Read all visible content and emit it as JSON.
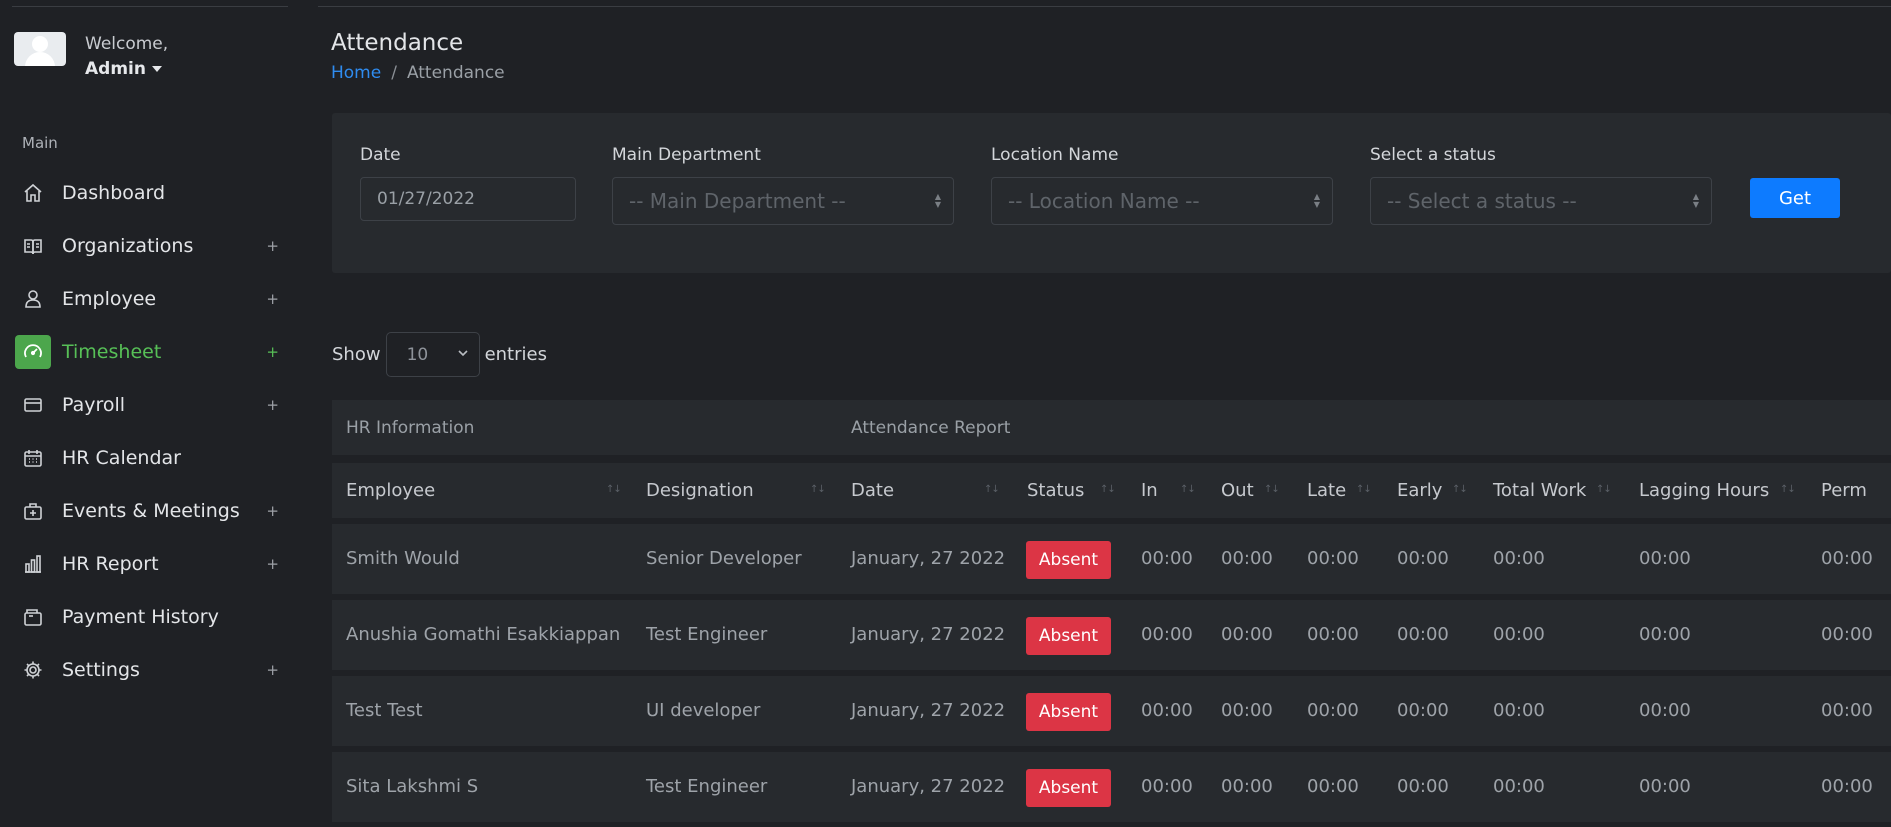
{
  "user": {
    "welcome": "Welcome,",
    "name": "Admin"
  },
  "sidebar": {
    "section_label": "Main",
    "items": [
      {
        "label": "Dashboard",
        "icon": "home-icon",
        "has_plus": false
      },
      {
        "label": "Organizations",
        "icon": "book-icon",
        "has_plus": true
      },
      {
        "label": "Employee",
        "icon": "user-icon",
        "has_plus": true
      },
      {
        "label": "Timesheet",
        "icon": "speedometer-icon",
        "has_plus": true,
        "active": true
      },
      {
        "label": "Payroll",
        "icon": "credit-card-icon",
        "has_plus": true
      },
      {
        "label": "HR Calendar",
        "icon": "calendar-icon",
        "has_plus": false
      },
      {
        "label": "Events & Meetings",
        "icon": "briefcase-icon",
        "has_plus": true
      },
      {
        "label": "HR Report",
        "icon": "bar-chart-icon",
        "has_plus": true
      },
      {
        "label": "Payment History",
        "icon": "wallet-icon",
        "has_plus": false
      },
      {
        "label": "Settings",
        "icon": "gear-icon",
        "has_plus": true
      }
    ],
    "plus": "+"
  },
  "page": {
    "title": "Attendance",
    "breadcrumb": {
      "home": "Home",
      "sep": "/",
      "current": "Attendance"
    }
  },
  "filters": {
    "date": {
      "label": "Date",
      "value": "01/27/2022"
    },
    "department": {
      "label": "Main Department",
      "placeholder": "-- Main Department --"
    },
    "location": {
      "label": "Location Name",
      "placeholder": "-- Location Name --"
    },
    "status": {
      "label": "Select a status",
      "placeholder": "-- Select a status --"
    },
    "submit_label": "Get"
  },
  "length_menu": {
    "show": "Show",
    "value": "10",
    "entries": "entries"
  },
  "table": {
    "groups": {
      "hr": "HR Information",
      "attendance": "Attendance Report"
    },
    "columns": [
      "Employee",
      "Designation",
      "Date",
      "Status",
      "In",
      "Out",
      "Late",
      "Early",
      "Total Work",
      "Lagging Hours",
      "Perm"
    ],
    "rows": [
      {
        "employee": "Smith Would",
        "designation": "Senior Developer",
        "date": "January, 27 2022",
        "status": "Absent",
        "in": "00:00",
        "out": "00:00",
        "late": "00:00",
        "early": "00:00",
        "total": "00:00",
        "lagging": "00:00",
        "perm": "00:00"
      },
      {
        "employee": "Anushia Gomathi Esakkiappan",
        "designation": "Test Engineer",
        "date": "January, 27 2022",
        "status": "Absent",
        "in": "00:00",
        "out": "00:00",
        "late": "00:00",
        "early": "00:00",
        "total": "00:00",
        "lagging": "00:00",
        "perm": "00:00"
      },
      {
        "employee": "Test Test",
        "designation": "UI developer",
        "date": "January, 27 2022",
        "status": "Absent",
        "in": "00:00",
        "out": "00:00",
        "late": "00:00",
        "early": "00:00",
        "total": "00:00",
        "lagging": "00:00",
        "perm": "00:00"
      },
      {
        "employee": "Sita Lakshmi S",
        "designation": "Test Engineer",
        "date": "January, 27 2022",
        "status": "Absent",
        "in": "00:00",
        "out": "00:00",
        "late": "00:00",
        "early": "00:00",
        "total": "00:00",
        "lagging": "00:00",
        "perm": "00:00"
      }
    ]
  },
  "colors": {
    "accent": "#0d7bff",
    "active": "#4ca64c",
    "danger": "#dc3545",
    "bg": "#1f2125",
    "card": "#272a2e"
  }
}
